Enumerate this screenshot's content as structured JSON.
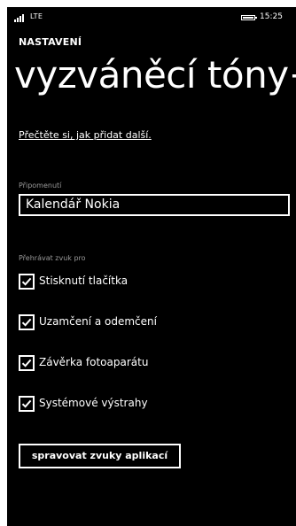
{
  "status_bar": {
    "network": "LTE",
    "time": "15:25",
    "signal_icon": "signal-bars-icon",
    "battery_icon": "battery-icon"
  },
  "header": {
    "app_title": "NASTAVENÍ",
    "page_title": "vyzváněcí tóny+"
  },
  "help_link": "Přečtěte si, jak přidat další.",
  "reminder": {
    "label": "Připomenutí",
    "value": "Kalendář Nokia"
  },
  "play_sound": {
    "label": "Přehrávat zvuk pro",
    "items": [
      {
        "label": "Stisknutí tlačítka",
        "checked": true
      },
      {
        "label": "Uzamčení a odemčení",
        "checked": true
      },
      {
        "label": "Závěrka fotoaparátu",
        "checked": true
      },
      {
        "label": "Systémové výstrahy",
        "checked": true
      }
    ]
  },
  "manage_button": "spravovat zvuky aplikací",
  "colors": {
    "background": "#000000",
    "foreground": "#ffffff",
    "muted_label": "#9a9a9a"
  }
}
